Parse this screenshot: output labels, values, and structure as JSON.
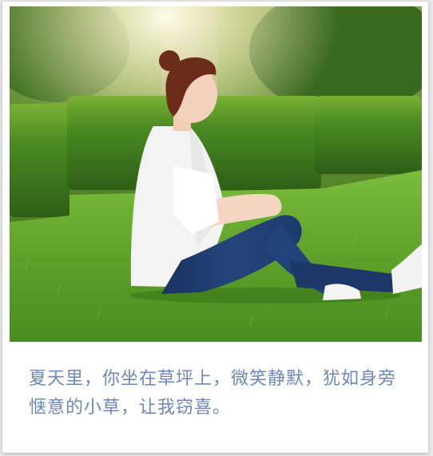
{
  "photo": {
    "subject": "woman sitting on lawn",
    "colors": {
      "grass": "#5fa12a",
      "hedge": "#3f7d1f",
      "shirt": "#f3f3f3",
      "jeans": "#1f3b6e",
      "sunlight": "#fff6d8"
    }
  },
  "caption": {
    "text": "夏天里，你坐在草坪上，微笑静默，犹如身旁惬意的小草，让我窃喜。",
    "color": "#6d87b6"
  }
}
